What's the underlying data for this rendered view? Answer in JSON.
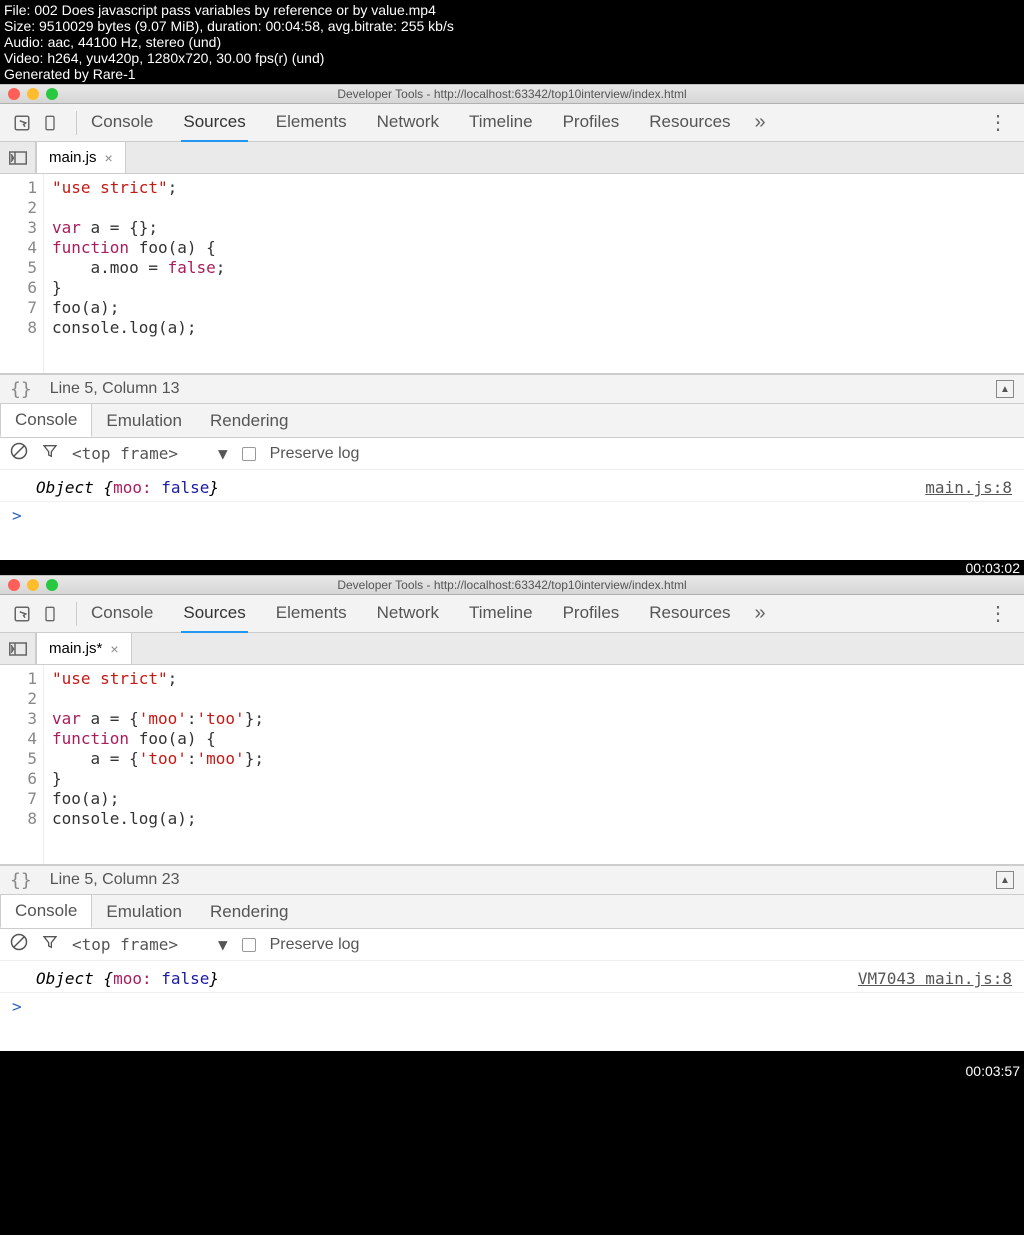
{
  "video_meta": {
    "file_line": "File: 002 Does javascript pass variables by reference or by value.mp4",
    "size_line": "Size: 9510029 bytes (9.07 MiB), duration: 00:04:58, avg.bitrate: 255 kb/s",
    "audio_line": "Audio: aac, 44100 Hz, stereo (und)",
    "video_line": "Video: h264, yuv420p, 1280x720, 30.00 fps(r) (und)",
    "gen_line": "Generated by Rare-1"
  },
  "timestamps": {
    "ts1": "00:03:02",
    "ts2": "00:03:57"
  },
  "titlebar": "Developer Tools - http://localhost:63342/top10interview/index.html",
  "tabs": {
    "console": "Console",
    "sources": "Sources",
    "elements": "Elements",
    "network": "Network",
    "timeline": "Timeline",
    "profiles": "Profiles",
    "resources": "Resources",
    "more": "»"
  },
  "drawer": {
    "console": "Console",
    "emulation": "Emulation",
    "rendering": "Rendering"
  },
  "console_toolbar": {
    "frame": "<top frame>",
    "preserve": "Preserve log"
  },
  "window1": {
    "file_tab": "main.js",
    "gutter": "1\n2\n3\n4\n5\n6\n7\n8",
    "status": "Line 5, Column 13",
    "console_obj_prefix": "Object {",
    "console_obj_key": "moo:",
    "console_obj_val": " false",
    "console_obj_suffix": "}",
    "console_src": "main.js:8",
    "prompt": ">"
  },
  "window2": {
    "file_tab": "main.js*",
    "gutter": "1\n2\n3\n4\n5\n6\n7\n8",
    "status": "Line 5, Column 23",
    "console_obj_prefix": "Object {",
    "console_obj_key": "moo:",
    "console_obj_val": " false",
    "console_obj_suffix": "}",
    "console_src": "VM7043 main.js:8",
    "prompt": ">"
  },
  "code1": {
    "l1_str": "\"use strict\"",
    "l1_sc": ";",
    "l3a": "var",
    "l3b": " a = {};",
    "l4a": "function",
    "l4b": " foo(a) {",
    "l5a": "    a.moo = ",
    "l5b": "false",
    "l5c": ";",
    "l6": "}",
    "l7": "foo(a);",
    "l8": "console.log(a);"
  },
  "code2": {
    "l1_str": "\"use strict\"",
    "l1_sc": ";",
    "l3a": "var",
    "l3b": " a = {",
    "l3c": "'moo'",
    "l3d": ":",
    "l3e": "'too'",
    "l3f": "};",
    "l4a": "function",
    "l4b": " foo(a) {",
    "l5a": "    a = {",
    "l5b": "'too'",
    "l5c": ":",
    "l5d": "'moo'",
    "l5e": "};",
    "l6": "}",
    "l7": "foo(a);",
    "l8": "console.log(a);"
  }
}
